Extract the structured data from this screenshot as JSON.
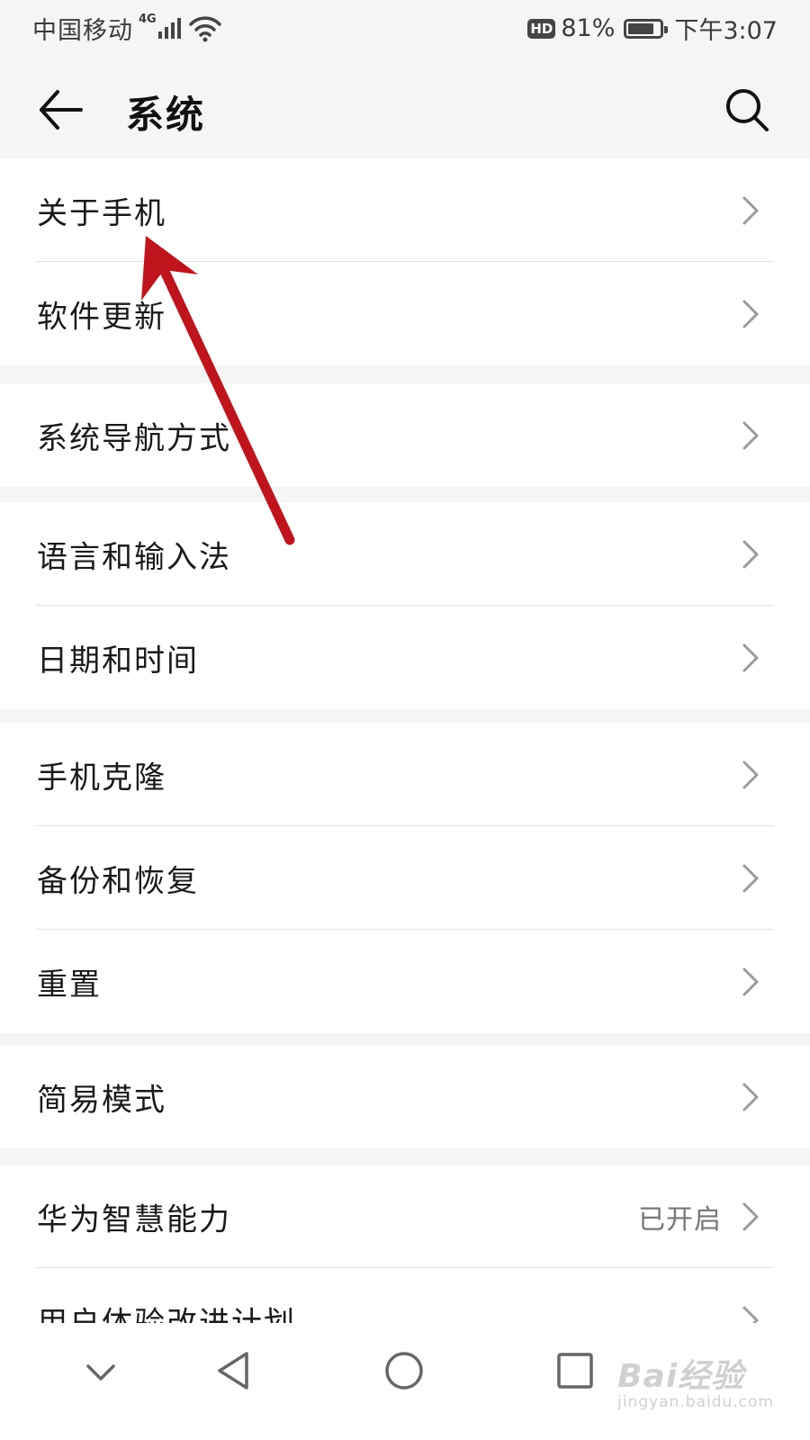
{
  "status_bar": {
    "carrier": "中国移动",
    "network": "4G",
    "hd_badge": "HD",
    "battery_percent": "81%",
    "battery_level": 0.81,
    "time": "下午3:07"
  },
  "app_bar": {
    "title": "系统"
  },
  "sections": [
    {
      "items": [
        {
          "label": "关于手机",
          "value": ""
        },
        {
          "label": "软件更新",
          "value": ""
        }
      ]
    },
    {
      "items": [
        {
          "label": "系统导航方式",
          "value": ""
        }
      ]
    },
    {
      "items": [
        {
          "label": "语言和输入法",
          "value": ""
        },
        {
          "label": "日期和时间",
          "value": ""
        }
      ]
    },
    {
      "items": [
        {
          "label": "手机克隆",
          "value": ""
        },
        {
          "label": "备份和恢复",
          "value": ""
        },
        {
          "label": "重置",
          "value": ""
        }
      ]
    },
    {
      "items": [
        {
          "label": "简易模式",
          "value": ""
        }
      ]
    },
    {
      "items": [
        {
          "label": "华为智慧能力",
          "value": "已开启"
        },
        {
          "label": "用户体验改进计划",
          "value": ""
        }
      ]
    }
  ],
  "watermark": {
    "brand": "Bai经验",
    "url": "jingyan.baidu.com"
  },
  "colors": {
    "annotation_arrow": "#c0141c",
    "background": "#f5f5f5",
    "card": "#ffffff"
  },
  "icons": {
    "back": "arrow-left",
    "search": "magnifier",
    "chevron": "chevron-right",
    "nav_hide": "chevron-down",
    "nav_back": "triangle-left",
    "nav_home": "circle",
    "nav_recents": "square"
  }
}
